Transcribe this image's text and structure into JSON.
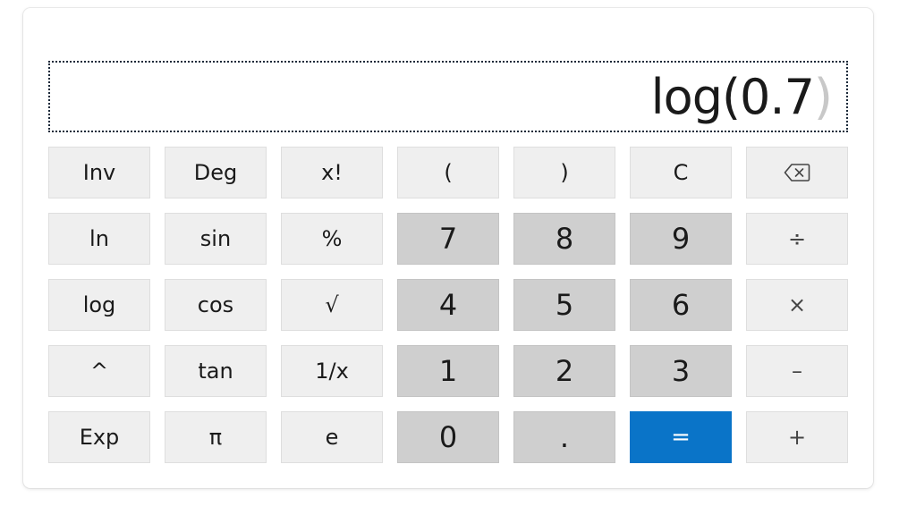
{
  "display": {
    "expression": "log(0.7",
    "ghost_paren": ")"
  },
  "keys": {
    "inv": "Inv",
    "deg": "Deg",
    "fact": "x!",
    "lparen": "(",
    "rparen": ")",
    "clear": "C",
    "ln": "ln",
    "sin": "sin",
    "percent": "%",
    "d7": "7",
    "d8": "8",
    "d9": "9",
    "divide": "÷",
    "log": "log",
    "cos": "cos",
    "sqrt": "√",
    "d4": "4",
    "d5": "5",
    "d6": "6",
    "multiply": "×",
    "pow": "^",
    "tan": "tan",
    "recip": "1/x",
    "d1": "1",
    "d2": "2",
    "d3": "3",
    "minus": "–",
    "exp": "Exp",
    "pi": "π",
    "e": "e",
    "d0": "0",
    "dot": ".",
    "equals": "=",
    "plus": "+"
  },
  "icons": {
    "backspace": "backspace-icon"
  },
  "colors": {
    "equals_bg": "#0a74c8",
    "digit_bg": "#cfcfcf",
    "function_bg": "#efefef"
  }
}
